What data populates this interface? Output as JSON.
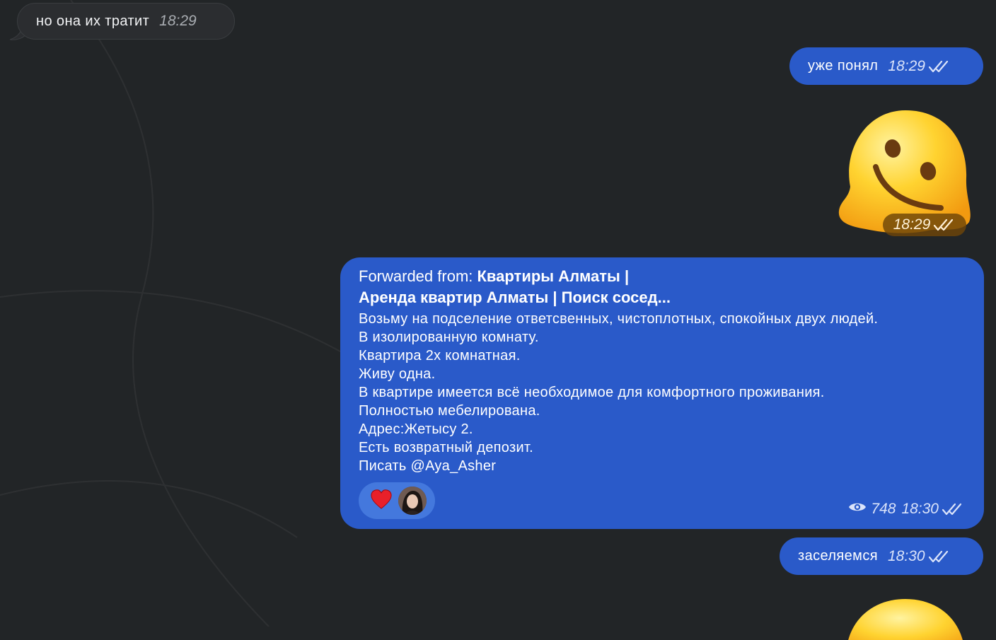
{
  "messages": {
    "incoming_1": {
      "text": "но она их тратит",
      "time": "18:29"
    },
    "outgoing_1": {
      "text": "уже понял",
      "time": "18:29"
    },
    "sticker_1": {
      "emoji": "melting-face",
      "time": "18:29"
    },
    "forwarded": {
      "prefix": "Forwarded from: ",
      "source_line1": "Квартиры Алматы |",
      "source_line2": "Аренда квартир Алматы | Поиск сосед...",
      "body": "Возьму на подселение ответсвенных, чистоплотных, спокойных  двух людей.\nВ изолированную комнату.\nКвартира 2х комнатная.\nЖиву одна.\nВ квартире имеется всё необходимое для комфортного проживания.\nПолностью мебелирована.\nАдрес:Жетысу 2.\nЕсть возвратный депозит.\nПисать @Aya_Asher",
      "reactions": [
        {
          "emoji": "red-heart",
          "reactor": "avatar"
        }
      ],
      "views": "748",
      "time": "18:30"
    },
    "outgoing_2": {
      "text": "заселяемся",
      "time": "18:30"
    },
    "sticker_2": {
      "emoji": "melting-face"
    }
  },
  "colors": {
    "background": "#222527",
    "incoming_bubble": "#2b2d30",
    "outgoing_bubble": "#2a5ac9",
    "reaction_pill": "#4478dd"
  }
}
